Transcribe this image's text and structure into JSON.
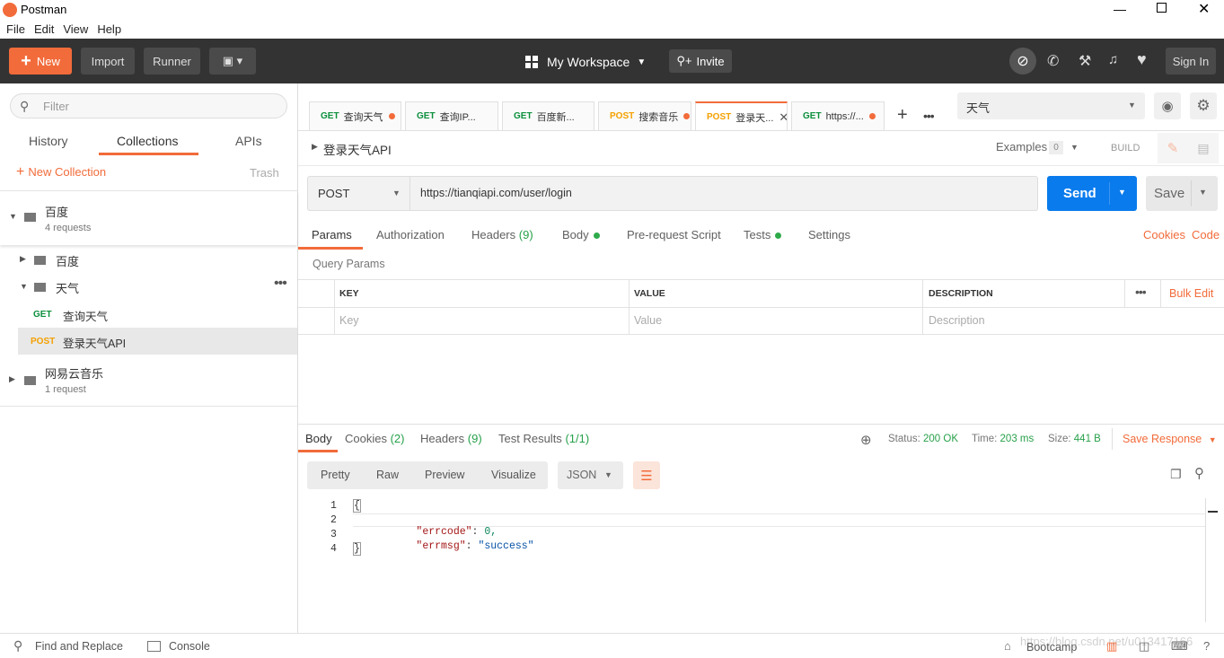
{
  "window": {
    "title": "Postman"
  },
  "menu": [
    "File",
    "Edit",
    "View",
    "Help"
  ],
  "header": {
    "new_label": "New",
    "import_label": "Import",
    "runner_label": "Runner",
    "workspace_label": "My Workspace",
    "invite_label": "Invite",
    "signin_label": "Sign In"
  },
  "sidebar": {
    "filter_placeholder": "Filter",
    "tabs": [
      "History",
      "Collections",
      "APIs"
    ],
    "new_collection_label": "New Collection",
    "trash_label": "Trash",
    "collections": [
      {
        "name": "百度",
        "count": "4 requests"
      },
      {
        "name": "网易云音乐",
        "count": "1 request"
      }
    ],
    "folders": [
      "百度",
      "天气"
    ],
    "requests": [
      {
        "method": "GET",
        "name": "查询天气"
      },
      {
        "method": "POST",
        "name": "登录天气API"
      }
    ]
  },
  "tabs": [
    {
      "method": "GET",
      "label": "查询天气"
    },
    {
      "method": "GET",
      "label": "查询IP..."
    },
    {
      "method": "GET",
      "label": "百度新..."
    },
    {
      "method": "POST",
      "label": "搜索音乐"
    },
    {
      "method": "POST",
      "label": "登录天..."
    },
    {
      "method": "GET",
      "label": "https://..."
    }
  ],
  "environment": {
    "selected": "天气"
  },
  "request": {
    "name": "登录天气API",
    "examples_label": "Examples",
    "examples_count": "0",
    "build_label": "BUILD",
    "method": "POST",
    "url": "https://tianqiapi.com/user/login",
    "send_label": "Send",
    "save_label": "Save"
  },
  "request_tabs": {
    "params": "Params",
    "authorization": "Authorization",
    "headers": "Headers",
    "headers_count": "(9)",
    "body": "Body",
    "prerequest": "Pre-request Script",
    "tests": "Tests",
    "settings": "Settings",
    "cookies": "Cookies",
    "code": "Code"
  },
  "params": {
    "section_title": "Query Params",
    "headers": [
      "KEY",
      "VALUE",
      "DESCRIPTION"
    ],
    "bulk_edit": "Bulk Edit",
    "placeholders": [
      "Key",
      "Value",
      "Description"
    ]
  },
  "response": {
    "tabs": {
      "body": "Body",
      "cookies": "Cookies",
      "cookies_count": "(2)",
      "headers": "Headers",
      "headers_count": "(9)",
      "tests": "Test Results",
      "tests_count": "(1/1)"
    },
    "status_label": "Status:",
    "status_value": "200 OK",
    "time_label": "Time:",
    "time_value": "203 ms",
    "size_label": "Size:",
    "size_value": "441 B",
    "save_response": "Save Response",
    "views": [
      "Pretty",
      "Raw",
      "Preview",
      "Visualize"
    ],
    "format": "JSON",
    "lines": [
      {
        "n": "1",
        "text": "{"
      },
      {
        "n": "2",
        "key": "\"errcode\"",
        "value": "0,"
      },
      {
        "n": "3",
        "key": "\"errmsg\"",
        "value": "\"success\""
      },
      {
        "n": "4",
        "text": "}"
      }
    ]
  },
  "footer": {
    "find_replace": "Find and Replace",
    "console": "Console",
    "bootcamp": "Bootcamp",
    "watermark": "https://blog.csdn.net/u013417166"
  },
  "colors": {
    "accent": "#f26b3a",
    "send_blue": "#097bed",
    "header_bg": "#333333"
  }
}
